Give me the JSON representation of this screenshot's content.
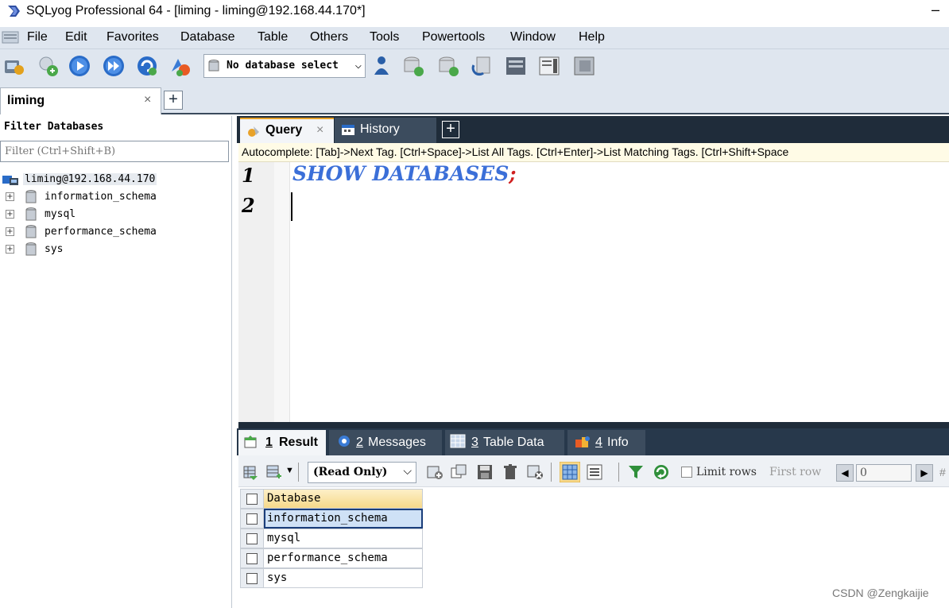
{
  "window": {
    "title": "SQLyog Professional 64 - [liming - liming@192.168.44.170*]",
    "minimize_glyph": "–"
  },
  "menu": {
    "items": [
      "File",
      "Edit",
      "Favorites",
      "Database",
      "Table",
      "Others",
      "Tools",
      "Powertools",
      "Window",
      "Help"
    ]
  },
  "toolbar": {
    "database_select": "No database select",
    "icons": [
      "new-connection-icon",
      "connection-manager-icon",
      "execute-query-icon",
      "execute-all-icon",
      "refresh-icon",
      "color-icon",
      "user-manager-icon",
      "create-database-icon",
      "create-table-icon",
      "backup-icon",
      "schema-designer-icon",
      "query-builder-icon",
      "table-data-icon"
    ]
  },
  "connection_tab": {
    "label": "liming",
    "close_glyph": "×",
    "add_glyph": "+"
  },
  "object_browser": {
    "filter_label": "Filter Databases",
    "filter_placeholder": "Filter (Ctrl+Shift+B)",
    "connection": "liming@192.168.44.170",
    "databases": [
      "information_schema",
      "mysql",
      "performance_schema",
      "sys"
    ]
  },
  "editor": {
    "tabs": [
      {
        "label": "Query",
        "close": "×",
        "active": true
      },
      {
        "label": "History",
        "active": false
      }
    ],
    "add_tab_glyph": "+",
    "autocomplete_hint": "Autocomplete: [Tab]->Next Tag. [Ctrl+Space]->List All Tags. [Ctrl+Enter]->List Matching Tags. [Ctrl+Shift+Space",
    "line_numbers": [
      "1",
      "2"
    ],
    "code": {
      "statement": "SHOW DATABASES",
      "terminator": ";"
    }
  },
  "results": {
    "tabs": [
      {
        "number": "1",
        "label": "Result",
        "active": true
      },
      {
        "number": "2",
        "label": "Messages"
      },
      {
        "number": "3",
        "label": "Table Data"
      },
      {
        "number": "4",
        "label": "Info"
      }
    ],
    "mode_select": "(Read Only)",
    "limit_rows_label": "Limit rows",
    "first_row_label": "First row",
    "first_row_value": "0",
    "hash_label": "#",
    "grid": {
      "columns": [
        "Database"
      ],
      "rows": [
        "information_schema",
        "mysql",
        "performance_schema",
        "sys"
      ],
      "selected_row": 0
    }
  },
  "watermark": "CSDN @Zengkaijie",
  "colors": {
    "chrome_bg": "#dfe6ef",
    "dark_tab_bar": "#1f2c3a",
    "keyword_blue": "#3b6fd8",
    "semicolon_red": "#d02020",
    "active_tab_accent": "#e8a22a",
    "selection": "#cfe1f6"
  }
}
